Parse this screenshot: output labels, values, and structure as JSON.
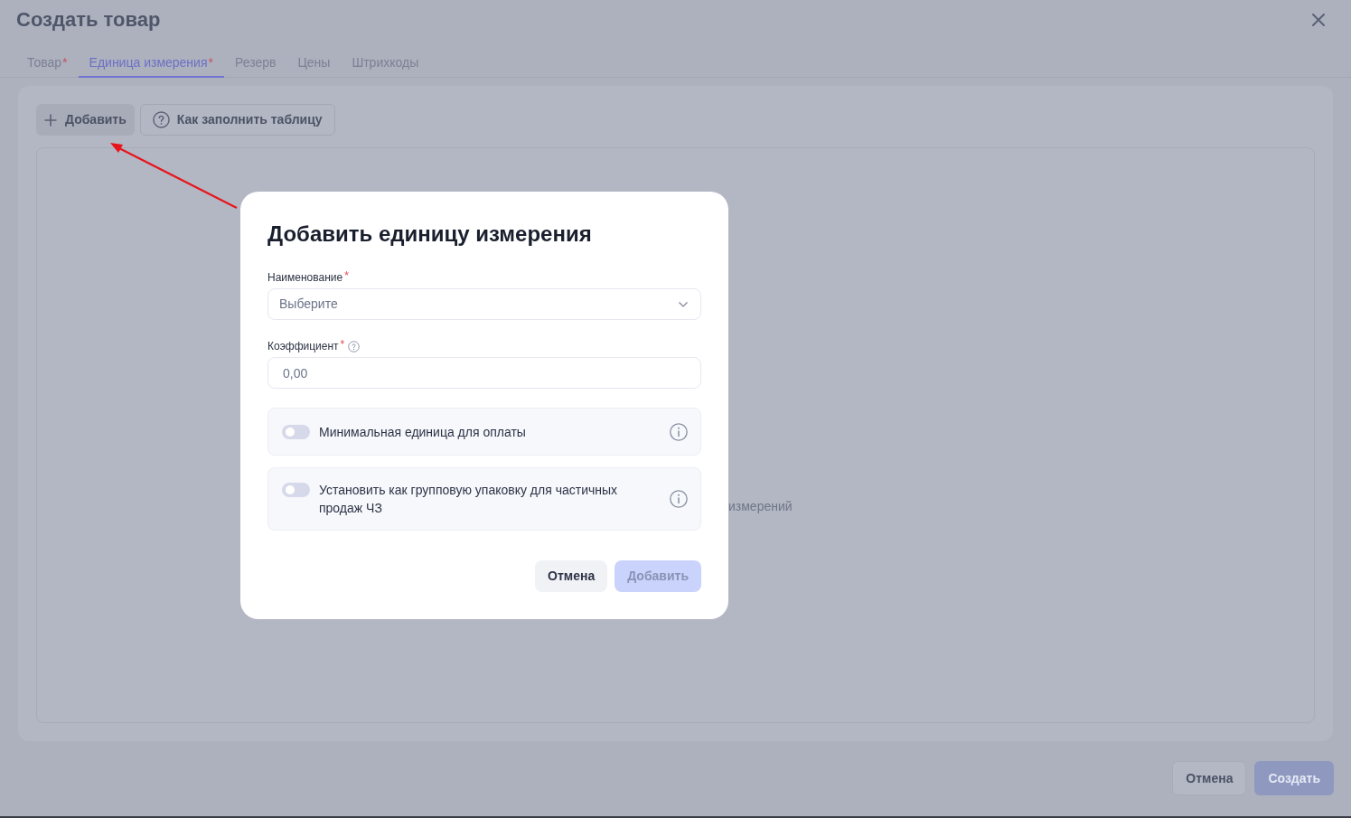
{
  "window": {
    "title": "Создать товар"
  },
  "tabs": [
    {
      "label": "Товар",
      "required_mark": "*",
      "selected": false
    },
    {
      "label": "Единица измерения",
      "required_mark": "*",
      "selected": true
    },
    {
      "label": "Резерв",
      "selected": false
    },
    {
      "label": "Цены",
      "selected": false
    },
    {
      "label": "Штрихкоды",
      "selected": false
    }
  ],
  "toolbar": {
    "buttons": [
      {
        "kind": "add",
        "label": "Добавить"
      },
      {
        "kind": "help",
        "label": "Как заполнить таблицу"
      }
    ]
  },
  "table_area": {
    "empty_text": "измерений"
  },
  "footer": {
    "buttons": [
      {
        "kind": "secondary",
        "label": "Отмена",
        "disabled": false
      },
      {
        "kind": "primary",
        "label": "Создать",
        "disabled": true
      }
    ]
  },
  "dialog": {
    "title": "Добавить единицу измерения",
    "fields": [
      {
        "kind": "select",
        "label": "Наименование",
        "required_mark": "*",
        "help": false,
        "placeholder": "Выберите"
      },
      {
        "kind": "input",
        "label": "Коэффициент",
        "required_mark": "*",
        "help": true,
        "placeholder": "0,00"
      }
    ],
    "toggles": [
      {
        "label": "Минимальная единица для оплаты",
        "on": false
      },
      {
        "label": "Установить как групповую упаковку для частичных продаж ЧЗ",
        "on": false
      }
    ],
    "buttons": [
      {
        "kind": "secondary",
        "label": "Отмена",
        "disabled": false
      },
      {
        "kind": "primary",
        "label": "Добавить",
        "disabled": true
      }
    ]
  }
}
